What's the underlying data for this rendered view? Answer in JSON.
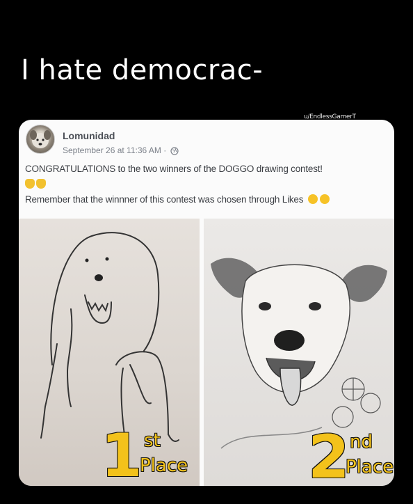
{
  "meme": {
    "caption": "I hate democrac-",
    "watermark": "u/EndlessGamerT"
  },
  "post": {
    "page_name": "Lomunidad",
    "date": "September 26 at 11:36 AM",
    "separator": "·",
    "line1": "CONGRATULATIONS to the two winners of the DOGGO drawing contest!",
    "line2": "Remember that the winnner of this contest was chosen through Likes"
  },
  "photos": {
    "first": {
      "number": "1",
      "suffix": "st",
      "word": "Place"
    },
    "second": {
      "number": "2",
      "suffix": "nd",
      "word": "Place"
    }
  },
  "icons": [
    "globe-icon",
    "cat-emoji-icon",
    "smile-emoji-icon"
  ],
  "colors": {
    "gold": "#f3c21b",
    "background": "#000000",
    "card": "#fbfbfb"
  }
}
